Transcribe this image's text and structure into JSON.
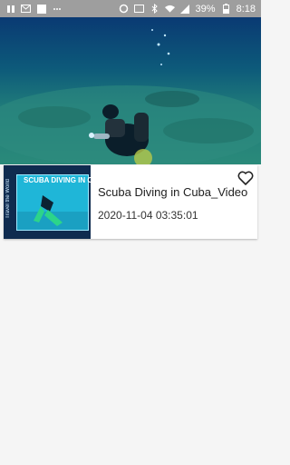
{
  "status_bar": {
    "battery": "39%",
    "time": "8:18"
  },
  "video_item": {
    "title": "Scuba Diving in Cuba_Video",
    "date": "2020-11-04 03:35:01",
    "thumbnail_title": "SCUBA DIVING IN CUBA",
    "thumbnail_side_text": "Travel the World"
  },
  "icons": {
    "favorite": "heart-outline-icon"
  },
  "colors": {
    "status_bar": "#9e9e9e",
    "card_bg": "#ffffff",
    "page_bg": "#f5f5f5"
  }
}
